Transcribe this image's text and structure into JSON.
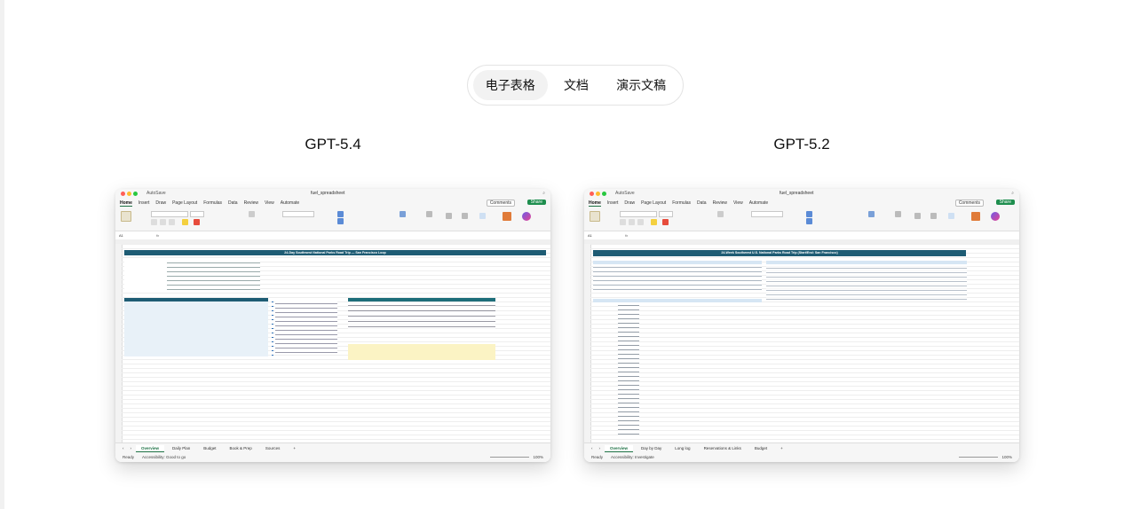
{
  "tabs": [
    {
      "label": "电子表格",
      "active": true
    },
    {
      "label": "文档",
      "active": false
    },
    {
      "label": "演示文稿",
      "active": false
    }
  ],
  "comparisons": [
    {
      "model": "GPT-5.4",
      "screenshot": {
        "autosave": "AutoSave",
        "file_name": "fuel_spreadsheet",
        "menus": [
          "Home",
          "Insert",
          "Draw",
          "Page Layout",
          "Formulas",
          "Data",
          "Review",
          "View",
          "Automate"
        ],
        "comments": "Comments",
        "share": "Share",
        "name_box": "A1",
        "title_banner": "24-Day Southwest National Parks Road Trip — San Francisco Loop",
        "sheet_tabs": [
          "Overview",
          "Daily Plan",
          "Budget",
          "Book & Prep",
          "Sources"
        ],
        "active_sheet": "Overview",
        "status_ready": "Ready",
        "status_accessibility": "Accessibility: Good to go",
        "zoom": "100%",
        "accent_color": "#1e5c74"
      }
    },
    {
      "model": "GPT-5.2",
      "screenshot": {
        "autosave": "AutoSave",
        "file_name": "fuel_spreadsheet",
        "menus": [
          "Home",
          "Insert",
          "Draw",
          "Page Layout",
          "Formulas",
          "Data",
          "Review",
          "View",
          "Automate"
        ],
        "comments": "Comments",
        "share": "Share",
        "name_box": "A1",
        "title_banner": "24-Week Southwest U.S. National Parks Road Trip (Start/End: San Francisco)",
        "sheet_tabs": [
          "Overview",
          "Day by Day",
          "Long log",
          "Reservations & Links",
          "Budget"
        ],
        "active_sheet": "Overview",
        "status_ready": "Ready",
        "status_accessibility": "Accessibility: Investigate",
        "zoom": "100%",
        "accent_color": "#1e5c74"
      }
    }
  ]
}
